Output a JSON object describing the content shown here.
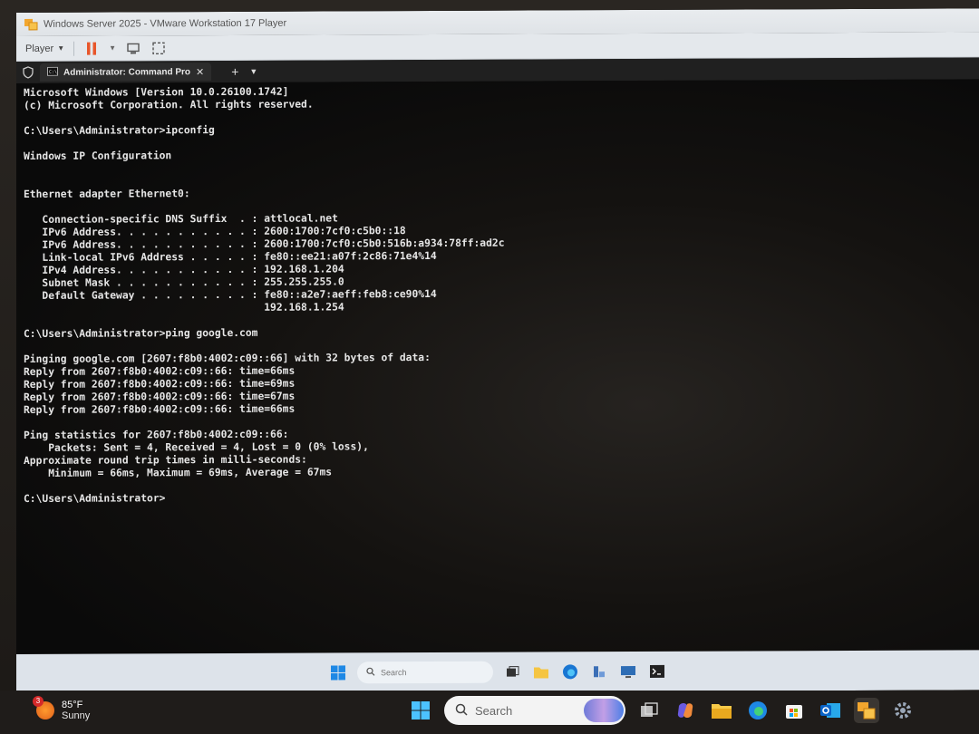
{
  "vm": {
    "title": "Windows Server 2025 - VMware Workstation 17 Player",
    "player_menu": "Player"
  },
  "terminal": {
    "tab_label": "Administrator: Command Pro",
    "lines": [
      "Microsoft Windows [Version 10.0.26100.1742]",
      "(c) Microsoft Corporation. All rights reserved.",
      "",
      "C:\\Users\\Administrator>ipconfig",
      "",
      "Windows IP Configuration",
      "",
      "",
      "Ethernet adapter Ethernet0:",
      "",
      "   Connection-specific DNS Suffix  . : attlocal.net",
      "   IPv6 Address. . . . . . . . . . . : 2600:1700:7cf0:c5b0::18",
      "   IPv6 Address. . . . . . . . . . . : 2600:1700:7cf0:c5b0:516b:a934:78ff:ad2c",
      "   Link-local IPv6 Address . . . . . : fe80::ee21:a07f:2c86:71e4%14",
      "   IPv4 Address. . . . . . . . . . . : 192.168.1.204",
      "   Subnet Mask . . . . . . . . . . . : 255.255.255.0",
      "   Default Gateway . . . . . . . . . : fe80::a2e7:aeff:feb8:ce90%14",
      "                                       192.168.1.254",
      "",
      "C:\\Users\\Administrator>ping google.com",
      "",
      "Pinging google.com [2607:f8b0:4002:c09::66] with 32 bytes of data:",
      "Reply from 2607:f8b0:4002:c09::66: time=66ms",
      "Reply from 2607:f8b0:4002:c09::66: time=69ms",
      "Reply from 2607:f8b0:4002:c09::66: time=67ms",
      "Reply from 2607:f8b0:4002:c09::66: time=66ms",
      "",
      "Ping statistics for 2607:f8b0:4002:c09::66:",
      "    Packets: Sent = 4, Received = 4, Lost = 0 (0% loss),",
      "Approximate round trip times in milli-seconds:",
      "    Minimum = 66ms, Maximum = 69ms, Average = 67ms",
      "",
      "C:\\Users\\Administrator>"
    ]
  },
  "vm_taskbar": {
    "search_placeholder": "Search"
  },
  "host_taskbar": {
    "weather_badge": "3",
    "weather_temp": "85°F",
    "weather_condition": "Sunny",
    "search_placeholder": "Search"
  },
  "colors": {
    "console_text": "#e6e6e6",
    "console_bg": "#0c0c0c",
    "vm_chrome": "#e4e8ec",
    "pause_orange": "#e8562a"
  }
}
